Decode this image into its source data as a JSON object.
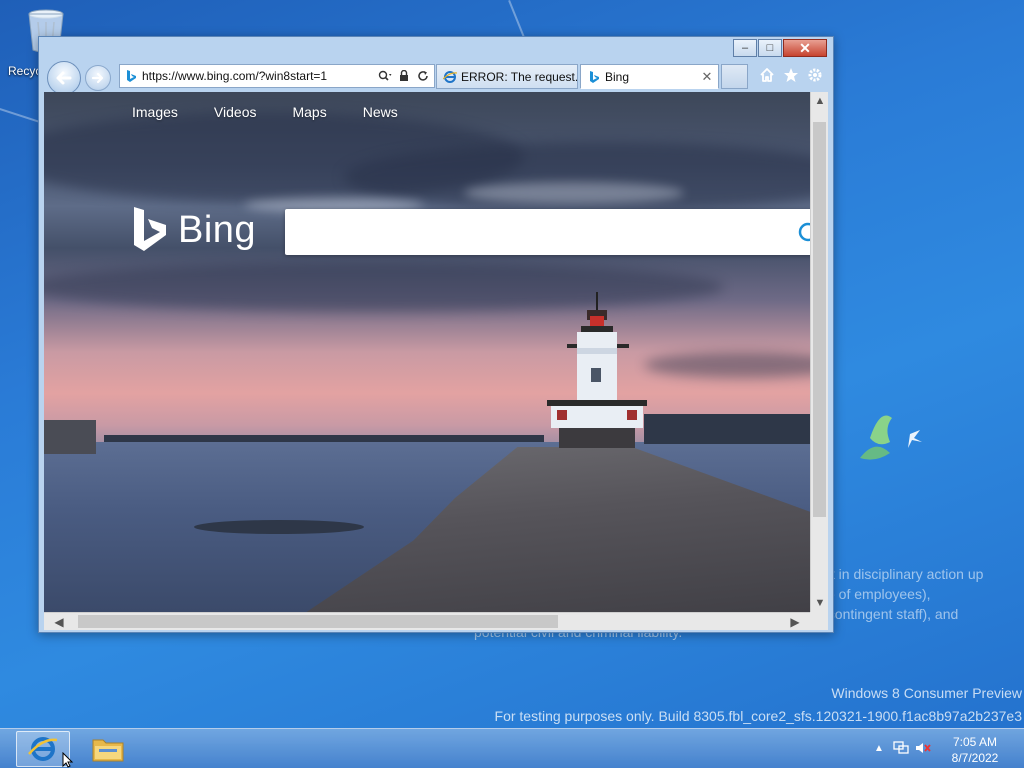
{
  "desktop": {
    "recycle_bin_label": "Recycle Bin",
    "notice_lines": [
      "ult in disciplinary action up",
      "se of employees),",
      "f contingent staff), and"
    ],
    "notice_tail": "potential civil and criminal liability.",
    "watermark_line1": "Windows 8 Consumer Preview",
    "watermark_line2": "For testing purposes only. Build 8305.fbl_core2_sfs.120321-1900.f1ac8b97a2b237e3"
  },
  "browser": {
    "address_url": "https://www.bing.com/?win8start=1",
    "tabs": [
      {
        "label": "ERROR: The request...",
        "active": false
      },
      {
        "label": "Bing",
        "active": true
      }
    ],
    "window_controls": {
      "minimize": "–",
      "maximize": "□",
      "close": "✕"
    }
  },
  "bing": {
    "nav": [
      "Images",
      "Videos",
      "Maps",
      "News"
    ],
    "logo_text": "Bing",
    "search_value": ""
  },
  "taskbar": {
    "time": "7:05 AM",
    "date": "8/7/2022"
  },
  "colors": {
    "desktop_blue": "#2a7bd6",
    "window_frame": "#b9d3ef",
    "close_red": "#c7432f"
  }
}
